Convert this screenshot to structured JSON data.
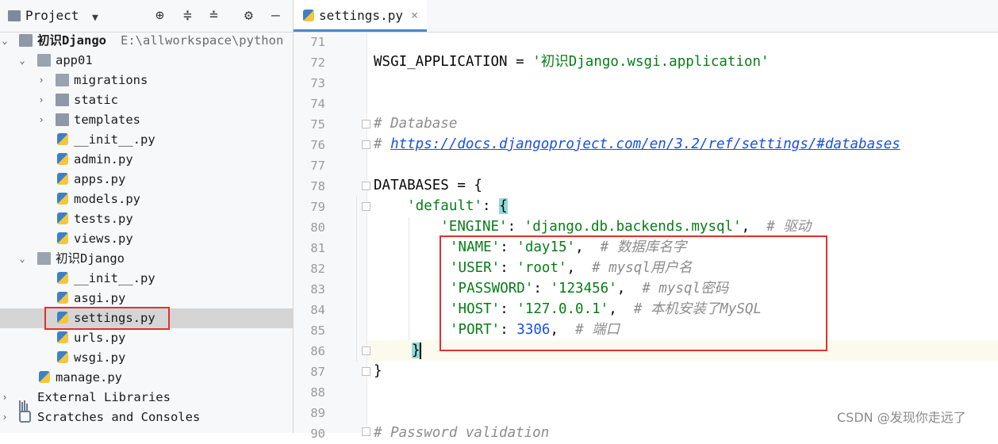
{
  "project_panel": {
    "title": "Project",
    "tree": [
      {
        "label": "初识Django",
        "path": "E:\\allworkspace\\python",
        "icon": "folder-icon",
        "expanded": true
      },
      {
        "label": "app01",
        "icon": "folder-icon",
        "expanded": true
      },
      {
        "label": "migrations",
        "icon": "folder-icon",
        "expanded": false
      },
      {
        "label": "static",
        "icon": "folder-icon",
        "expanded": false
      },
      {
        "label": "templates",
        "icon": "folder-icon",
        "expanded": false
      },
      {
        "label": "__init__.py",
        "icon": "python-file-icon"
      },
      {
        "label": "admin.py",
        "icon": "python-file-icon"
      },
      {
        "label": "apps.py",
        "icon": "python-file-icon"
      },
      {
        "label": "models.py",
        "icon": "python-file-icon"
      },
      {
        "label": "tests.py",
        "icon": "python-file-icon"
      },
      {
        "label": "views.py",
        "icon": "python-file-icon"
      },
      {
        "label": "初识Django",
        "icon": "folder-icon",
        "expanded": true
      },
      {
        "label": "__init__.py",
        "icon": "python-file-icon"
      },
      {
        "label": "asgi.py",
        "icon": "python-file-icon"
      },
      {
        "label": "settings.py",
        "icon": "python-file-icon",
        "selected": true
      },
      {
        "label": "urls.py",
        "icon": "python-file-icon"
      },
      {
        "label": "wsgi.py",
        "icon": "python-file-icon"
      },
      {
        "label": "manage.py",
        "icon": "python-file-icon"
      },
      {
        "label": "External Libraries",
        "icon": "library-icon",
        "expanded": false
      },
      {
        "label": "Scratches and Consoles",
        "icon": "scratches-icon",
        "expanded": false
      }
    ]
  },
  "editor": {
    "tab": {
      "label": "settings.py",
      "close": "×"
    },
    "line_numbers": [
      "71",
      "72",
      "73",
      "74",
      "75",
      "76",
      "77",
      "78",
      "79",
      "80",
      "81",
      "82",
      "83",
      "84",
      "85",
      "86",
      "87",
      "88",
      "89",
      "90"
    ],
    "code": {
      "l72_var": "WSGI_APPLICATION = ",
      "l72_str": "'初识Django.wsgi.application'",
      "l75_comment": "# Database",
      "l76_hash": "# ",
      "l76_url": "https://docs.djangoproject.com/en/3.2/ref/settings/#databases",
      "l78_code": "DATABASES = {",
      "l79_indent": "    ",
      "l79_key": "'default'",
      "l79_colon": ": ",
      "l79_brace": "{",
      "l80_indent": "        ",
      "l80_key": "'ENGINE'",
      "l80_sep": ": ",
      "l80_val": "'django.db.backends.mysql'",
      "l80_comma": ",  ",
      "l80_comment": "# 驱动",
      "l81_key": "'NAME'",
      "l81_val": "'day15'",
      "l81_comment": "# 数据库名字",
      "l82_key": "'USER'",
      "l82_val": "'root'",
      "l82_comment": "# mysql用户名",
      "l83_key": "'PASSWORD'",
      "l83_val": "'123456'",
      "l83_comment": "# mysql密码",
      "l84_key": "'HOST'",
      "l84_val": "'127.0.0.1'",
      "l84_comment": "# 本机安装了MySQL",
      "l85_key": "'PORT'",
      "l85_val": "3306",
      "l85_comment": "# 端口",
      "l86_brace": "}",
      "l87_brace": "}",
      "l90_comment": "# Password validation"
    }
  },
  "watermark": "CSDN @发现你走远了",
  "colors": {
    "highlight_box": "#e03030",
    "string": "#067d17",
    "comment": "#8c8c8c",
    "number": "#1750eb"
  }
}
